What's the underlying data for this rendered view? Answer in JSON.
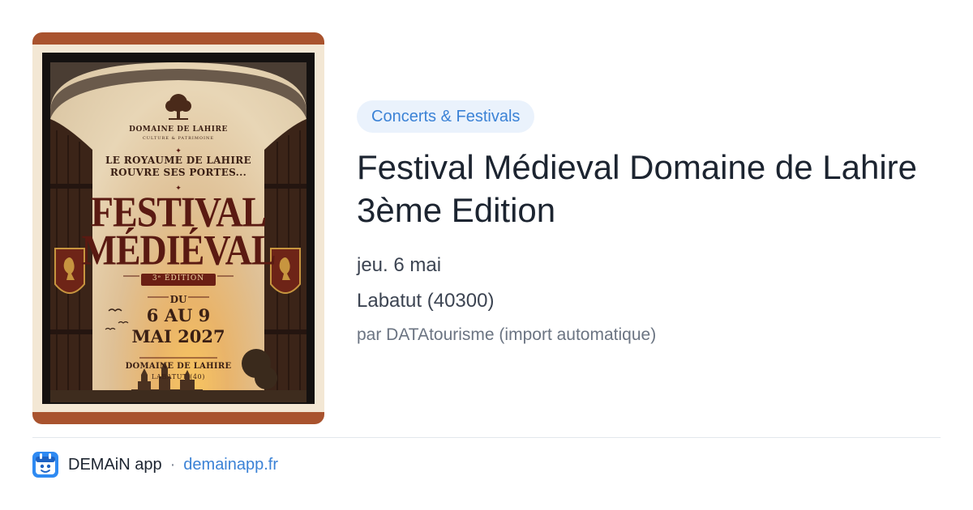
{
  "poster": {
    "org_name": "DOMAINE DE LAHIRE",
    "org_tagline": "CULTURE & PATRIMOINE",
    "tagline_line1": "LE ROYAUME DE LAHIRE",
    "tagline_line2": "ROUVRE SES PORTES...",
    "title_line1": "FESTIVAL",
    "title_line2": "MÉDIÉVAL",
    "edition": "3ᵉ ÉDITION",
    "date_prefix": "DU",
    "date_line1": "6 AU 9",
    "date_line2": "MAI 2027",
    "venue": "DOMAINE DE LAHIRE",
    "town": "LABATUT (40)"
  },
  "event": {
    "category": "Concerts & Festivals",
    "title": "Festival Médieval Domaine de Lahire 3ème Edition",
    "date": "jeu. 6 mai",
    "location": "Labatut (40300)",
    "source": "par DATAtourisme (import automatique)"
  },
  "footer": {
    "app_name": "DEMAiN app",
    "separator": "·",
    "site": "demainapp.fr"
  },
  "colors": {
    "accent": "#3b82d6",
    "pill_bg": "#eaf2fc",
    "poster_border": "#a9532e"
  }
}
